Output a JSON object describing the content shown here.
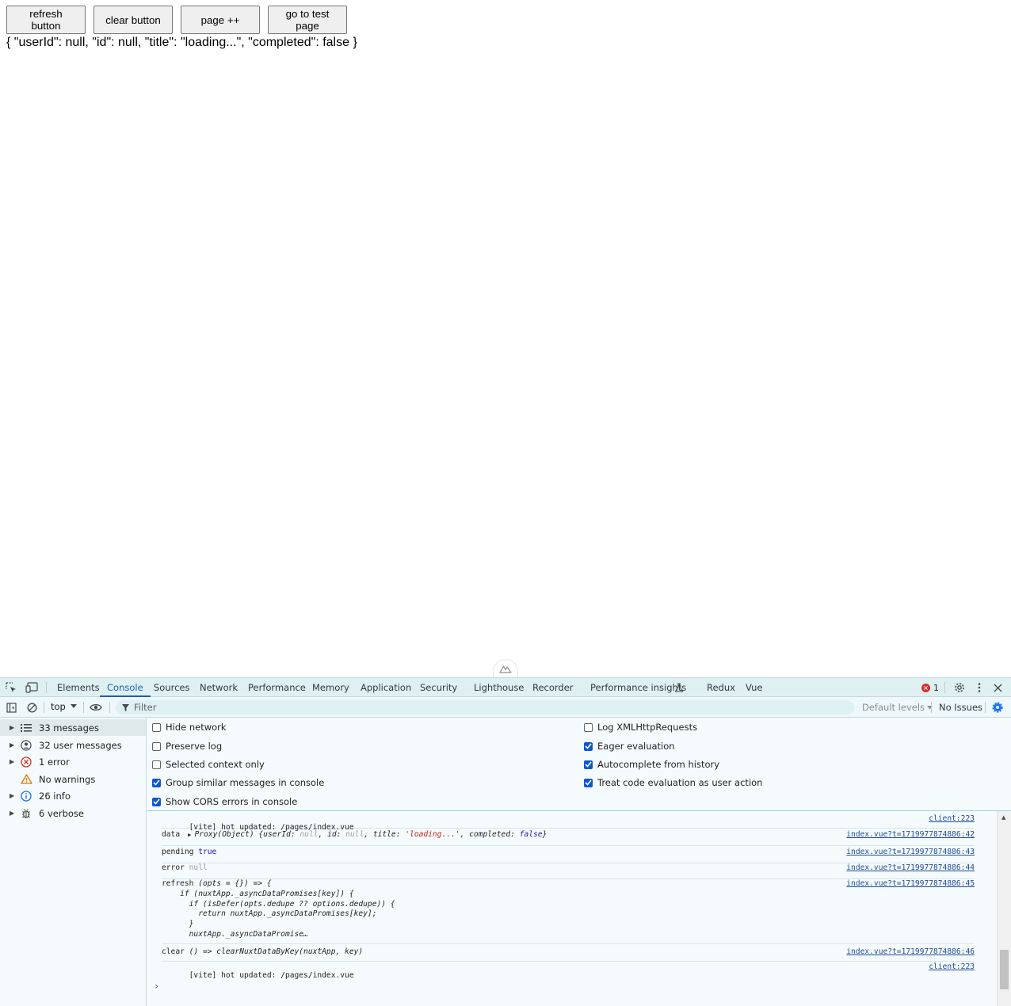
{
  "page": {
    "buttons": {
      "refresh": "refresh button",
      "clear": "clear button",
      "page_inc": "page ++",
      "go_test": "go to test page"
    },
    "json_output": "{ \"userId\": null, \"id\": null, \"title\": \"loading...\", \"completed\": false }"
  },
  "devtools": {
    "tabs": [
      "Elements",
      "Console",
      "Sources",
      "Network",
      "Performance",
      "Memory",
      "Application",
      "Security",
      "Lighthouse",
      "Recorder",
      "Performance insights",
      "Redux",
      "Vue"
    ],
    "active_tab": "Console",
    "error_count": "1",
    "toolbar": {
      "context": "top",
      "filter_placeholder": "Filter",
      "levels": "Default levels",
      "issues": "No Issues"
    },
    "sidebar": {
      "items": [
        {
          "label": "33 messages",
          "icon": "list-icon"
        },
        {
          "label": "32 user messages",
          "icon": "user-icon"
        },
        {
          "label": "1 error",
          "icon": "error-icon"
        },
        {
          "label": "No warnings",
          "icon": "warning-icon"
        },
        {
          "label": "26 info",
          "icon": "info-icon"
        },
        {
          "label": "6 verbose",
          "icon": "bug-icon"
        }
      ]
    },
    "settings": {
      "left": [
        {
          "label": "Hide network",
          "checked": false
        },
        {
          "label": "Preserve log",
          "checked": false
        },
        {
          "label": "Selected context only",
          "checked": false
        },
        {
          "label": "Group similar messages in console",
          "checked": true
        },
        {
          "label": "Show CORS errors in console",
          "checked": true
        }
      ],
      "right": [
        {
          "label": "Log XMLHttpRequests",
          "checked": false
        },
        {
          "label": "Eager evaluation",
          "checked": true
        },
        {
          "label": "Autocomplete from history",
          "checked": true
        },
        {
          "label": "Treat code evaluation as user action",
          "checked": true
        }
      ]
    },
    "messages": {
      "m1": {
        "text": "[vite] hot updated: /pages/index.vue",
        "source": "client:223"
      },
      "m2": {
        "prefix": "data ",
        "proxy": "Proxy(Object) {userId: ",
        "null1": "null",
        "mid1": ", id: ",
        "null2": "null",
        "mid2": ", title: ",
        "str": "'loading...'",
        "mid3": ", completed: ",
        "bool": "false",
        "end": "}",
        "source": "index.vue?t=1719977874886:42"
      },
      "m3": {
        "prefix": "pending ",
        "value": "true",
        "source": "index.vue?t=1719977874886:43"
      },
      "m4": {
        "prefix": "error ",
        "value": "null",
        "source": "index.vue?t=1719977874886:44"
      },
      "m5": {
        "prefix": "refresh ",
        "code": "(opts = {}) => {\n    if (nuxtApp._asyncDataPromises[key]) {\n      if (isDefer(opts.dedupe ?? options.dedupe)) {\n        return nuxtApp._asyncDataPromises[key];\n      }\n      nuxtApp._asyncDataPromise…",
        "source": "index.vue?t=1719977874886:45"
      },
      "m6": {
        "prefix": "clear ",
        "code": "() => clearNuxtDataByKey(nuxtApp, key)",
        "source": "index.vue?t=1719977874886:46"
      },
      "m7": {
        "text": "[vite] hot updated: /pages/index.vue",
        "source": "client:223"
      }
    },
    "prompt": "›"
  }
}
